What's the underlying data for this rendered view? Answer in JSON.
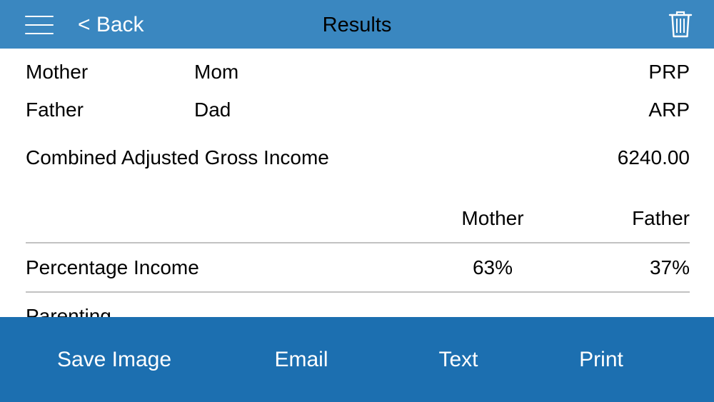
{
  "header": {
    "back_label": "< Back",
    "title": "Results",
    "menu_icon": "hamburger-menu-icon",
    "delete_icon": "trash-icon"
  },
  "parents": [
    {
      "role": "Mother",
      "name": "Mom",
      "code": "PRP"
    },
    {
      "role": "Father",
      "name": "Dad",
      "code": "ARP"
    }
  ],
  "combined_income": {
    "label": "Combined Adjusted Gross Income",
    "value": "6240.00"
  },
  "table": {
    "columns": [
      "Mother",
      "Father"
    ],
    "rows": [
      {
        "label": "Percentage Income",
        "mother": "63%",
        "father": "37%"
      },
      {
        "label": "Parenting"
      }
    ]
  },
  "toolbar": {
    "buttons": [
      "Save Image",
      "Email",
      "Text",
      "Print"
    ]
  },
  "colors": {
    "navbar": "#3a87c0",
    "toolbar": "#1c6fb0",
    "divider": "#c2c2c2"
  }
}
